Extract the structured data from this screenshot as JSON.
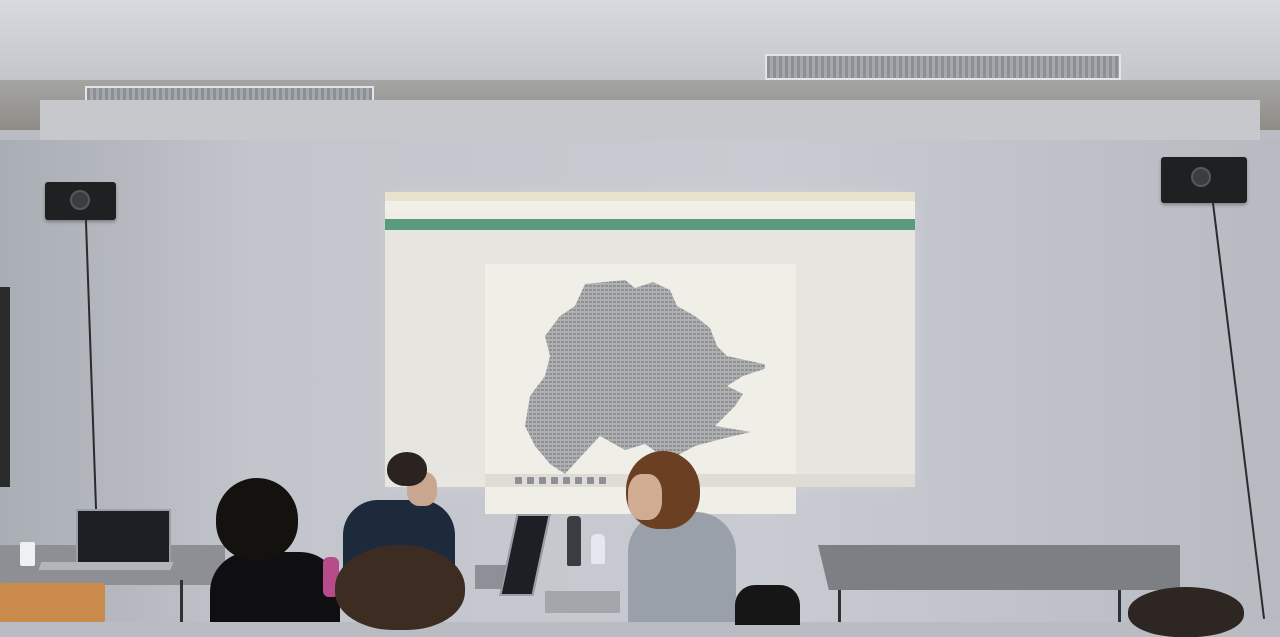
{
  "scene": {
    "description_tags": [
      "classroom",
      "projector-screen",
      "laptops",
      "students"
    ],
    "projection": {
      "browser_tabs": [],
      "address": "",
      "bookmarks": "",
      "menus": []
    }
  },
  "colors": {
    "wall": "#c5c8ce",
    "app_toolbar": "#5a9b80",
    "projected_page": "#efeee7",
    "ascii_art": "#8d8f93"
  }
}
